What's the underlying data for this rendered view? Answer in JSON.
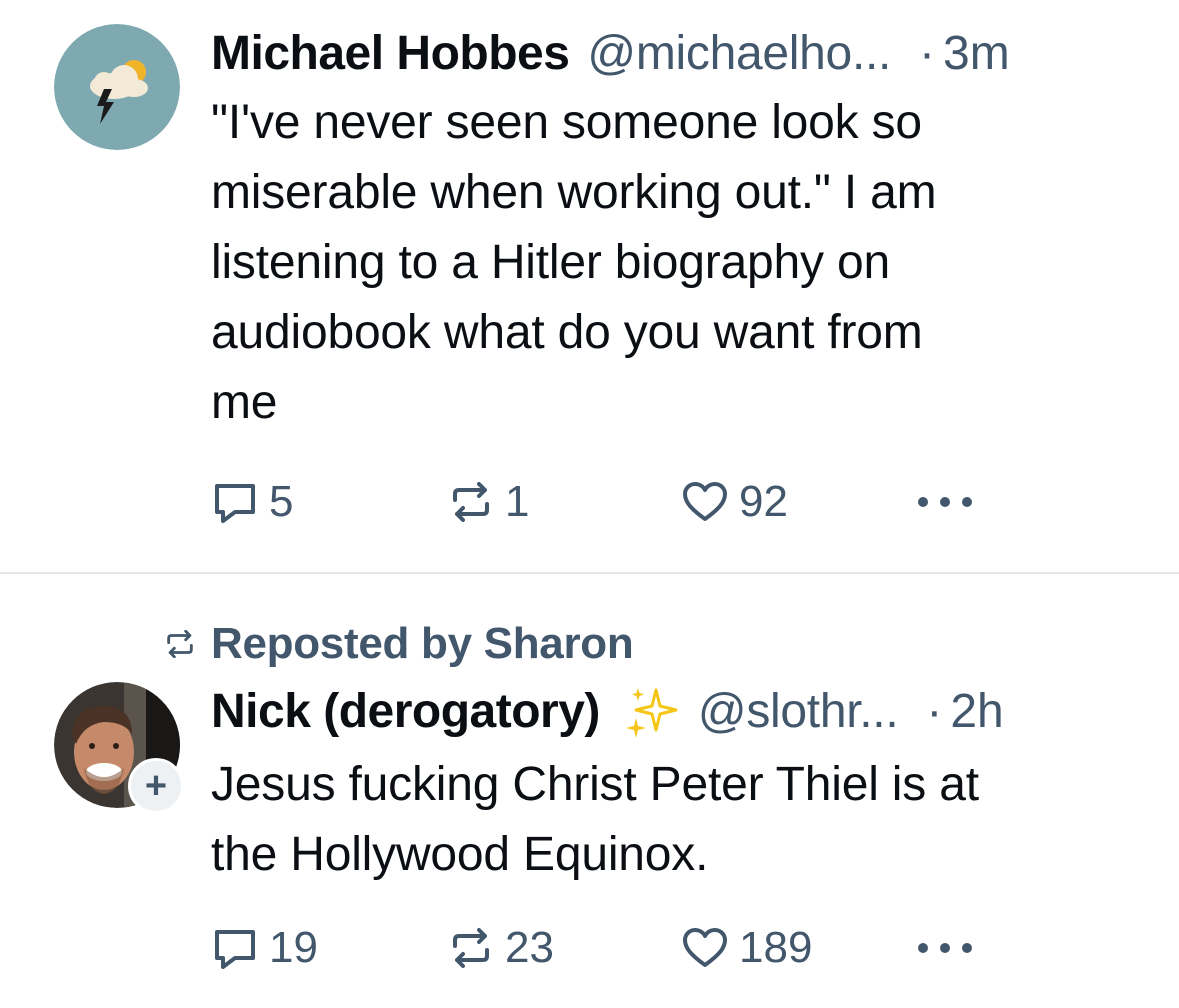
{
  "posts": [
    {
      "author_name": "Michael Hobbes",
      "handle": "@michaelho...",
      "dot": "·",
      "time": "3m",
      "text_lines": [
        "\"I've never seen someone look so",
        "miserable when working out.\" I am",
        "listening to a Hitler biography on",
        "audiobook what do you want from",
        "me"
      ],
      "avatar_icon": "cloud-lightning-sun-icon",
      "replies": "5",
      "reposts": "1",
      "likes": "92"
    },
    {
      "repost_by": "Reposted by Sharon",
      "author_name": "Nick (derogatory)",
      "name_emoji": "sparkles-icon",
      "handle": "@slothr...",
      "dot": "·",
      "time": "2h",
      "text_lines": [
        "Jesus fucking Christ Peter Thiel is at",
        "the Hollywood Equinox."
      ],
      "avatar_badge": "+",
      "replies": "19",
      "reposts": "23",
      "likes": "189"
    }
  ],
  "colors": {
    "text": "#0b0f14",
    "muted": "#42576c",
    "divider": "#e3e7eb",
    "avatar_bg": "#7fa9b0",
    "sparkle": "#f5c518"
  }
}
